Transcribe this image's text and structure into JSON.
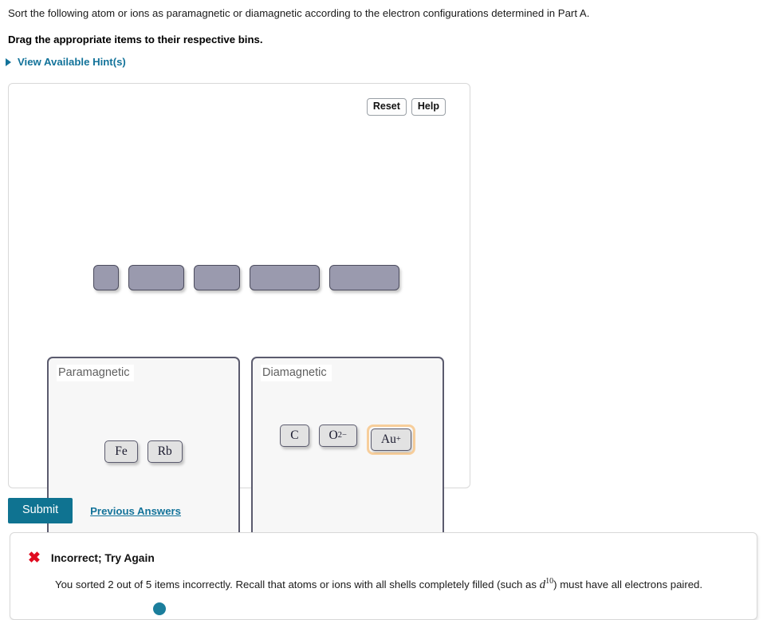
{
  "prompt": {
    "question": "Sort the following atom or ions as paramagnetic or diamagnetic according to the electron configurations determined in Part A.",
    "instruction": "Drag the appropriate items to their respective bins.",
    "hints_label": "View Available Hint(s)",
    "hints_icon": "triangle-right-icon"
  },
  "answer_card": {
    "reset_label": "Reset",
    "help_label": "Help"
  },
  "tray": {
    "placeholders": [
      {
        "width": 32
      },
      {
        "width": 70
      },
      {
        "width": 58
      },
      {
        "width": 88
      },
      {
        "width": 88
      }
    ]
  },
  "bins": [
    {
      "title": "Paramagnetic",
      "items": [
        {
          "label": "Fe",
          "sup": "",
          "selected": false
        },
        {
          "label": "Rb",
          "sup": "",
          "selected": false
        }
      ]
    },
    {
      "title": "Diamagnetic",
      "items": [
        {
          "label": "C",
          "sup": "",
          "selected": false
        },
        {
          "label": "O",
          "sup": "2−",
          "selected": false
        },
        {
          "label": "Au",
          "sup": "+",
          "selected": true
        }
      ]
    }
  ],
  "actions": {
    "submit_label": "Submit",
    "previous_answers_label": "Previous Answers"
  },
  "feedback": {
    "icon": "red-x-icon",
    "title": "Incorrect; Try Again",
    "body_before_math": "You sorted 2 out of 5 items incorrectly. Recall that atoms or ions with all shells completely filled (such as ",
    "math_base": "d",
    "math_sup": "10",
    "body_after_math": ") must have all electrons paired."
  },
  "colors": {
    "accent": "#13739a",
    "submit": "#0f7391",
    "error": "#e00b20",
    "chip_fill": "#e2e2e2",
    "chip_border": "#5b5b6e",
    "placeholder_fill": "#9a9aae",
    "selected_ring": "#f7ce9b",
    "bin_fill": "#f7f7f7"
  }
}
